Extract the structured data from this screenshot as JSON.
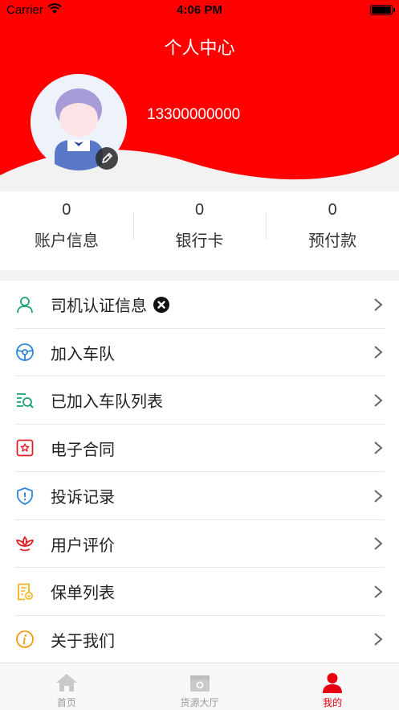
{
  "status_bar": {
    "carrier": "Carrier",
    "time": "4:06 PM"
  },
  "header": {
    "title": "个人中心",
    "phone": "13300000000"
  },
  "stats": [
    {
      "value": "0",
      "label": "账户信息"
    },
    {
      "value": "0",
      "label": "银行卡"
    },
    {
      "value": "0",
      "label": "预付款"
    }
  ],
  "menu": [
    {
      "label": "司机认证信息",
      "icon": "person-outline-icon",
      "status": "unverified-x-icon"
    },
    {
      "label": "加入车队",
      "icon": "steering-wheel-icon"
    },
    {
      "label": "已加入车队列表",
      "icon": "list-search-icon"
    },
    {
      "label": "电子合同",
      "icon": "contract-star-icon"
    },
    {
      "label": "投诉记录",
      "icon": "shield-alert-icon"
    },
    {
      "label": "用户评价",
      "icon": "lotus-icon"
    },
    {
      "label": "保单列表",
      "icon": "policy-document-icon"
    },
    {
      "label": "关于我们",
      "icon": "info-circle-icon"
    }
  ],
  "tabbar": [
    {
      "label": "首页",
      "icon": "home-icon",
      "active": false
    },
    {
      "label": "货源大厅",
      "icon": "cargo-hall-icon",
      "active": false
    },
    {
      "label": "我的",
      "icon": "person-icon",
      "active": true
    }
  ],
  "colors": {
    "brand_red": "#ff0000",
    "active_red": "#e60012",
    "teal": "#1aa37a",
    "blue": "#2e86de",
    "orange": "#f39c12"
  }
}
